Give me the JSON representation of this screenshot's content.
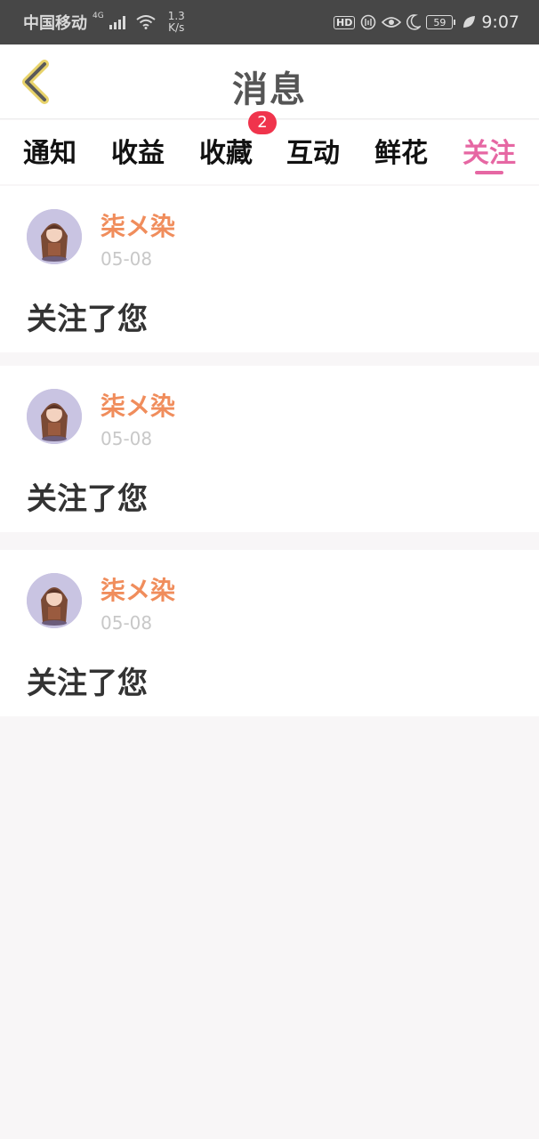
{
  "status_bar": {
    "carrier": "中国移动",
    "network": "4G",
    "speed_value": "1.3",
    "speed_unit": "K/s",
    "hd": "HD",
    "battery": "59",
    "time": "9:07"
  },
  "header": {
    "title": "消息",
    "back_icon": "chevron-left-icon"
  },
  "tabs": [
    {
      "label": "通知",
      "active": false
    },
    {
      "label": "收益",
      "active": false
    },
    {
      "label": "收藏",
      "active": false,
      "badge": "2"
    },
    {
      "label": "互动",
      "active": false
    },
    {
      "label": "鲜花",
      "active": false
    },
    {
      "label": "关注",
      "active": true
    }
  ],
  "accent_color": "#e667a3",
  "notifications": [
    {
      "username": "柒メ染",
      "date": "05-08",
      "message": "关注了您"
    },
    {
      "username": "柒メ染",
      "date": "05-08",
      "message": "关注了您"
    },
    {
      "username": "柒メ染",
      "date": "05-08",
      "message": "关注了您"
    }
  ]
}
